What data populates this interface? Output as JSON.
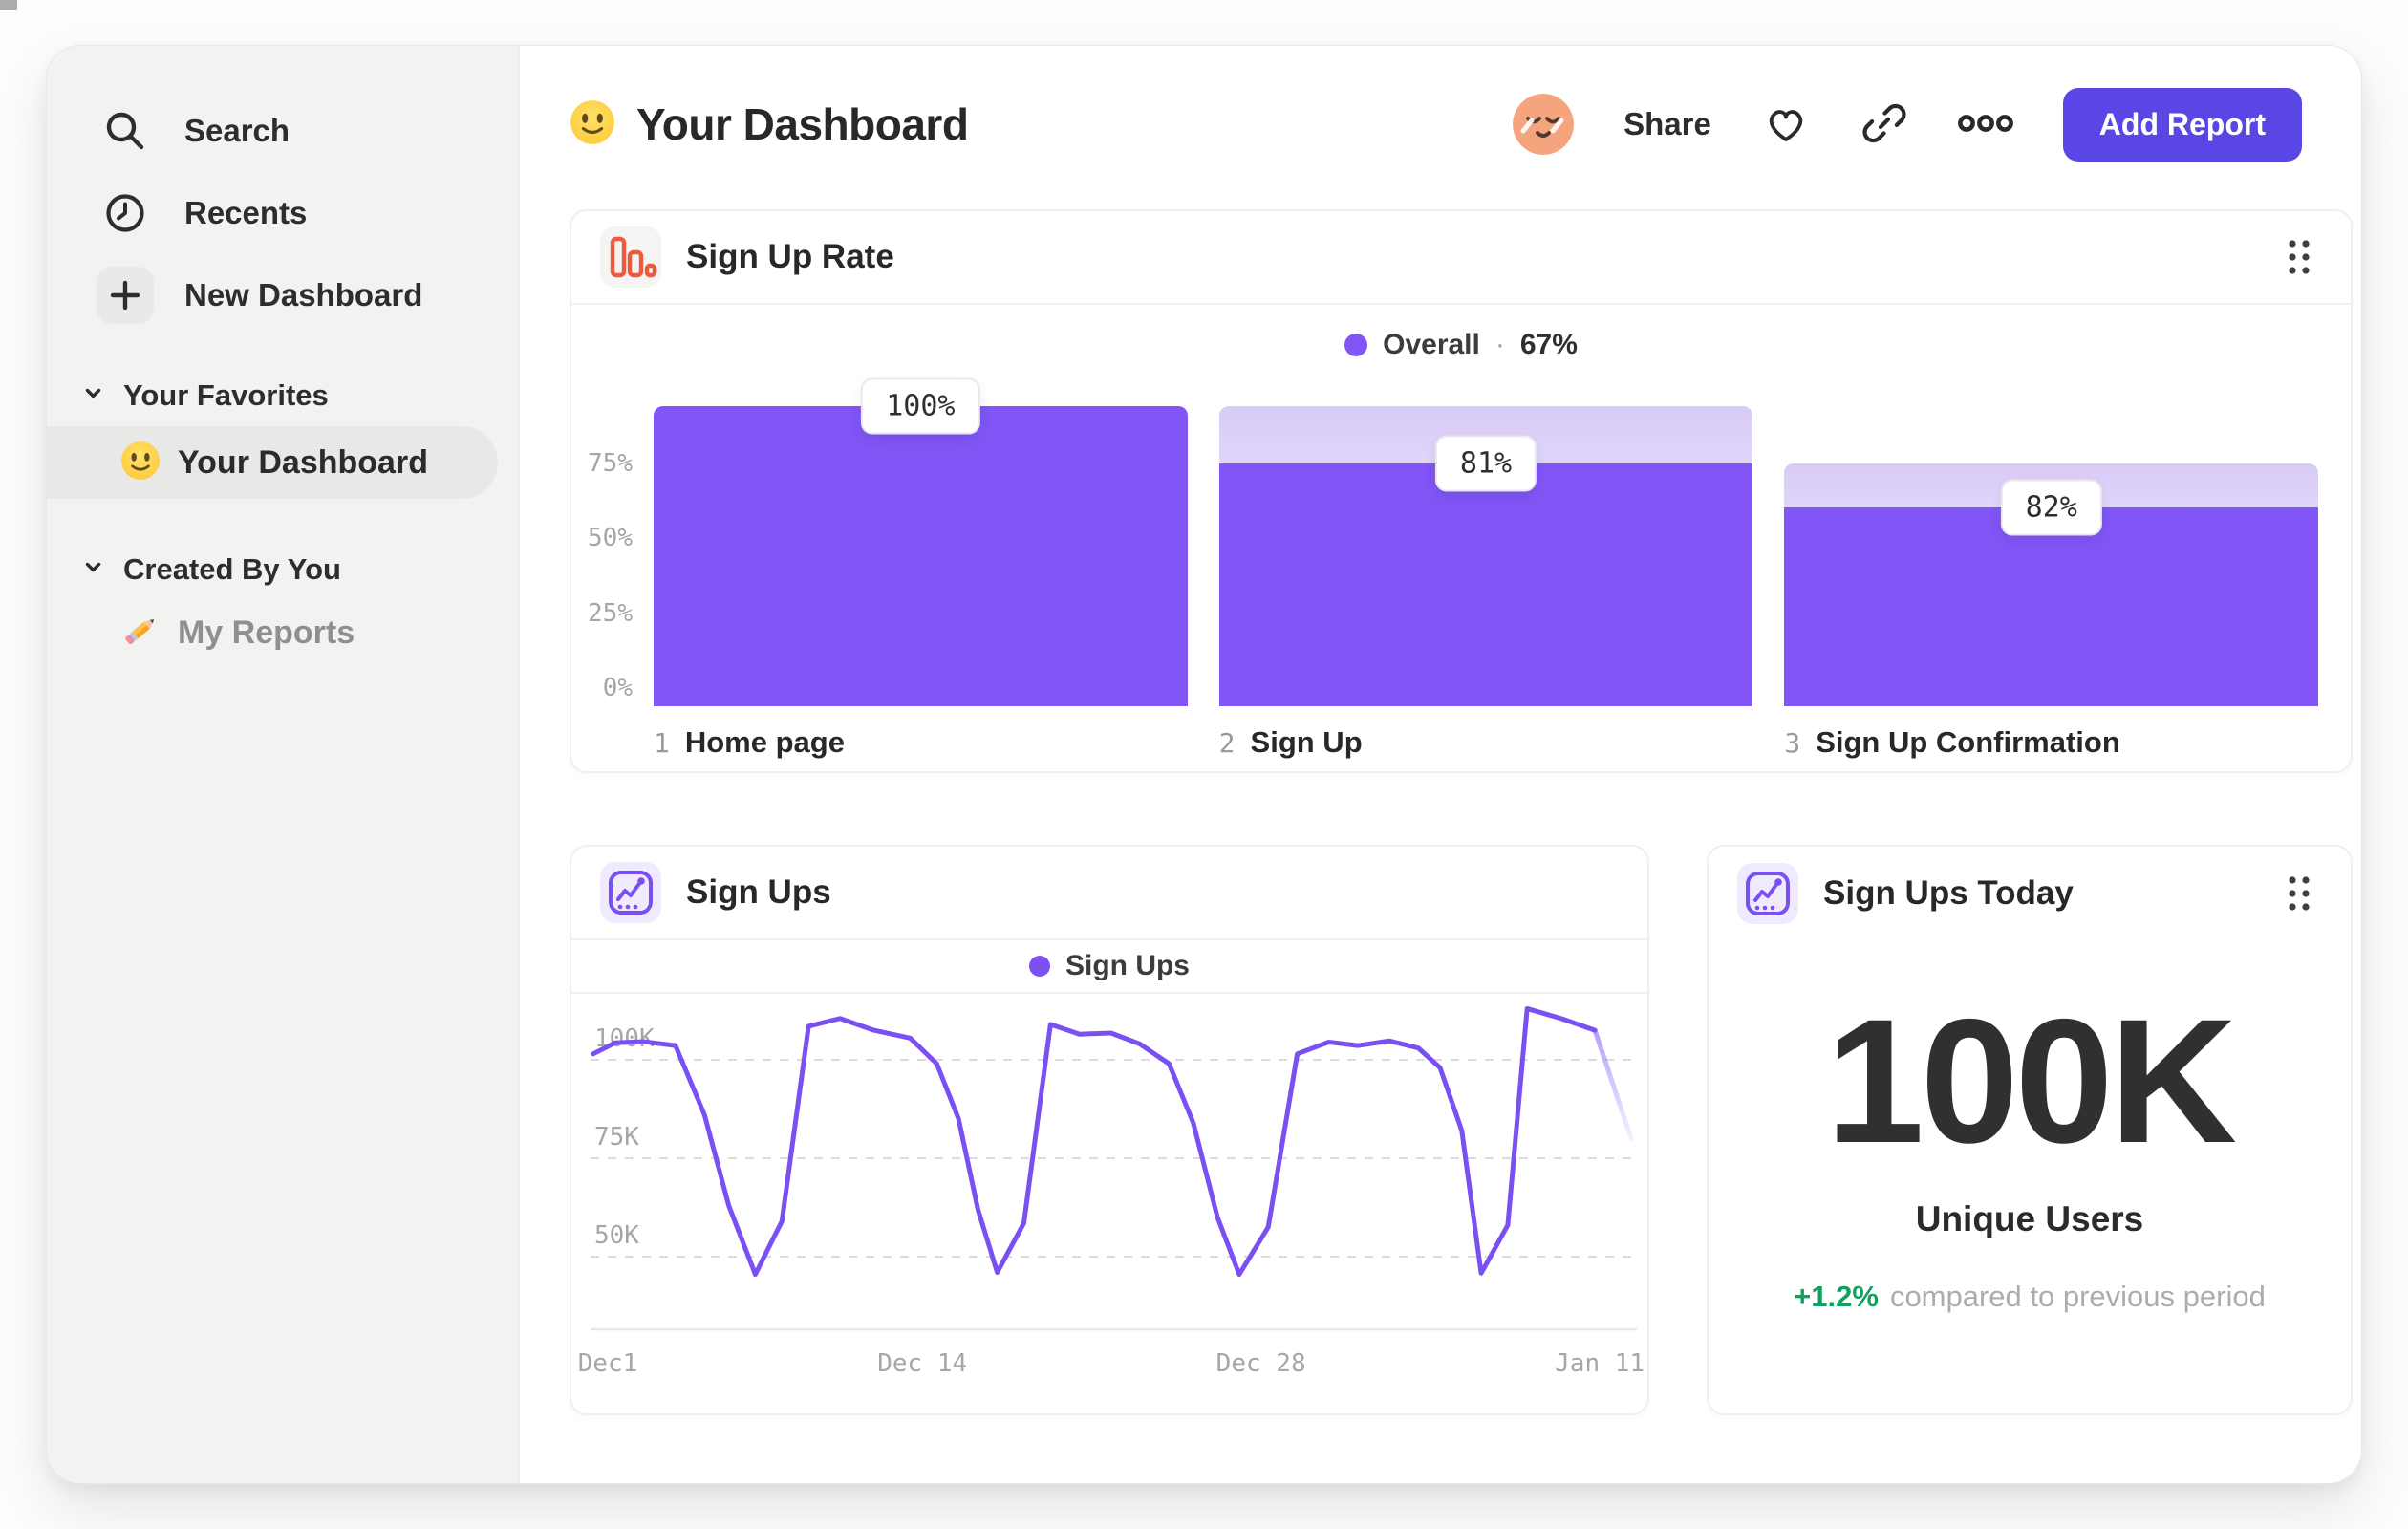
{
  "colors": {
    "funnel_bar": "#8155F6",
    "funnel_ghost_top": "#D8CBF8",
    "line": "#7B50F2",
    "primary_button": "#5A46E4",
    "funnel_icon_orange": "#EE5A3D",
    "delta_green": "#11A15E",
    "sidebar_bg": "#F2F2F1",
    "avatar_bg": "#F5A57D"
  },
  "sidebar": {
    "nav": [
      {
        "icon": "search-icon",
        "label": "Search"
      },
      {
        "icon": "clock-icon",
        "label": "Recents"
      },
      {
        "icon": "plus-icon",
        "label": "New Dashboard"
      }
    ],
    "sections": [
      {
        "title": "Your Favorites",
        "items": [
          {
            "emoji": "slightly-smiling-face",
            "label": "Your Dashboard",
            "selected": true
          }
        ]
      },
      {
        "title": "Created By You",
        "items": [
          {
            "emoji": "pencil",
            "label": "My Reports",
            "selected": false
          }
        ]
      }
    ]
  },
  "header": {
    "emoji": "slightly-smiling-face",
    "title": "Your Dashboard",
    "share_label": "Share",
    "add_report_label": "Add Report",
    "icons": [
      "avatar",
      "heart-icon",
      "link-icon",
      "more-icon"
    ]
  },
  "chart_data": [
    {
      "type": "bar",
      "subtype": "funnel",
      "title": "Sign Up Rate",
      "legend": {
        "label": "Overall",
        "sep": "·",
        "value": "67%"
      },
      "ylim": [
        0,
        100
      ],
      "grid": false,
      "legend_position": "top-center",
      "yticks": [
        {
          "label": "0%",
          "pct": 0
        },
        {
          "label": "25%",
          "pct": 25
        },
        {
          "label": "50%",
          "pct": 50
        },
        {
          "label": "75%",
          "pct": 75
        }
      ],
      "steps": [
        {
          "index": "1",
          "name": "Home page",
          "conversion_label": "100%",
          "container_pct": 100,
          "solid_pct": 100
        },
        {
          "index": "2",
          "name": "Sign Up",
          "conversion_label": "81%",
          "container_pct": 100,
          "solid_pct": 81
        },
        {
          "index": "3",
          "name": "Sign Up Confirmation",
          "conversion_label": "82%",
          "container_pct": 81,
          "solid_pct": 66.4
        }
      ]
    },
    {
      "type": "line",
      "title": "Sign Ups",
      "legend": "Sign Ups",
      "unit": "K users",
      "x_unit": "day offset from Dec 1",
      "ylim_k": [
        30,
        115
      ],
      "grid": "dashed horizontal at 50K/75K/100K",
      "legend_position": "top-center",
      "yticks": [
        {
          "label": "100K",
          "value": 100
        },
        {
          "label": "75K",
          "value": 75
        },
        {
          "label": "50K",
          "value": 50
        }
      ],
      "xticks": [
        {
          "label": "Dec1",
          "day": 0
        },
        {
          "label": "Dec 14",
          "day": 13
        },
        {
          "label": "Dec 28",
          "day": 27
        },
        {
          "label": "Jan 11",
          "day": 41
        }
      ],
      "fade_from_day": 40.8,
      "series": [
        [
          -0.6,
          101.5
        ],
        [
          0.3,
          104.3
        ],
        [
          1.5,
          104.6
        ],
        [
          2.8,
          103.6
        ],
        [
          4,
          86
        ],
        [
          5,
          63
        ],
        [
          6.1,
          45.5
        ],
        [
          7.2,
          59
        ],
        [
          8.3,
          108.5
        ],
        [
          9.6,
          110.5
        ],
        [
          11,
          107.5
        ],
        [
          12.5,
          105.5
        ],
        [
          13.6,
          99
        ],
        [
          14.5,
          85
        ],
        [
          15.3,
          62
        ],
        [
          16.1,
          46
        ],
        [
          17.2,
          58.5
        ],
        [
          18.3,
          109
        ],
        [
          19.5,
          106.5
        ],
        [
          20.8,
          106.8
        ],
        [
          22,
          104
        ],
        [
          23.2,
          99
        ],
        [
          24.2,
          84
        ],
        [
          25.2,
          60
        ],
        [
          26.1,
          45.5
        ],
        [
          27.3,
          57.5
        ],
        [
          28.5,
          101.5
        ],
        [
          29.8,
          104.5
        ],
        [
          31,
          103.6
        ],
        [
          32.3,
          104.8
        ],
        [
          33.5,
          103
        ],
        [
          34.4,
          98
        ],
        [
          35.3,
          82
        ],
        [
          36.1,
          45.8
        ],
        [
          37.2,
          58
        ],
        [
          38,
          113
        ],
        [
          39.4,
          110.5
        ],
        [
          40.8,
          107.5
        ],
        [
          42.3,
          80
        ]
      ]
    },
    {
      "type": "metric",
      "title": "Sign Ups Today",
      "value": "100K",
      "label": "Unique Users",
      "delta": "+1.2%",
      "delta_note": "compared to previous period"
    }
  ]
}
